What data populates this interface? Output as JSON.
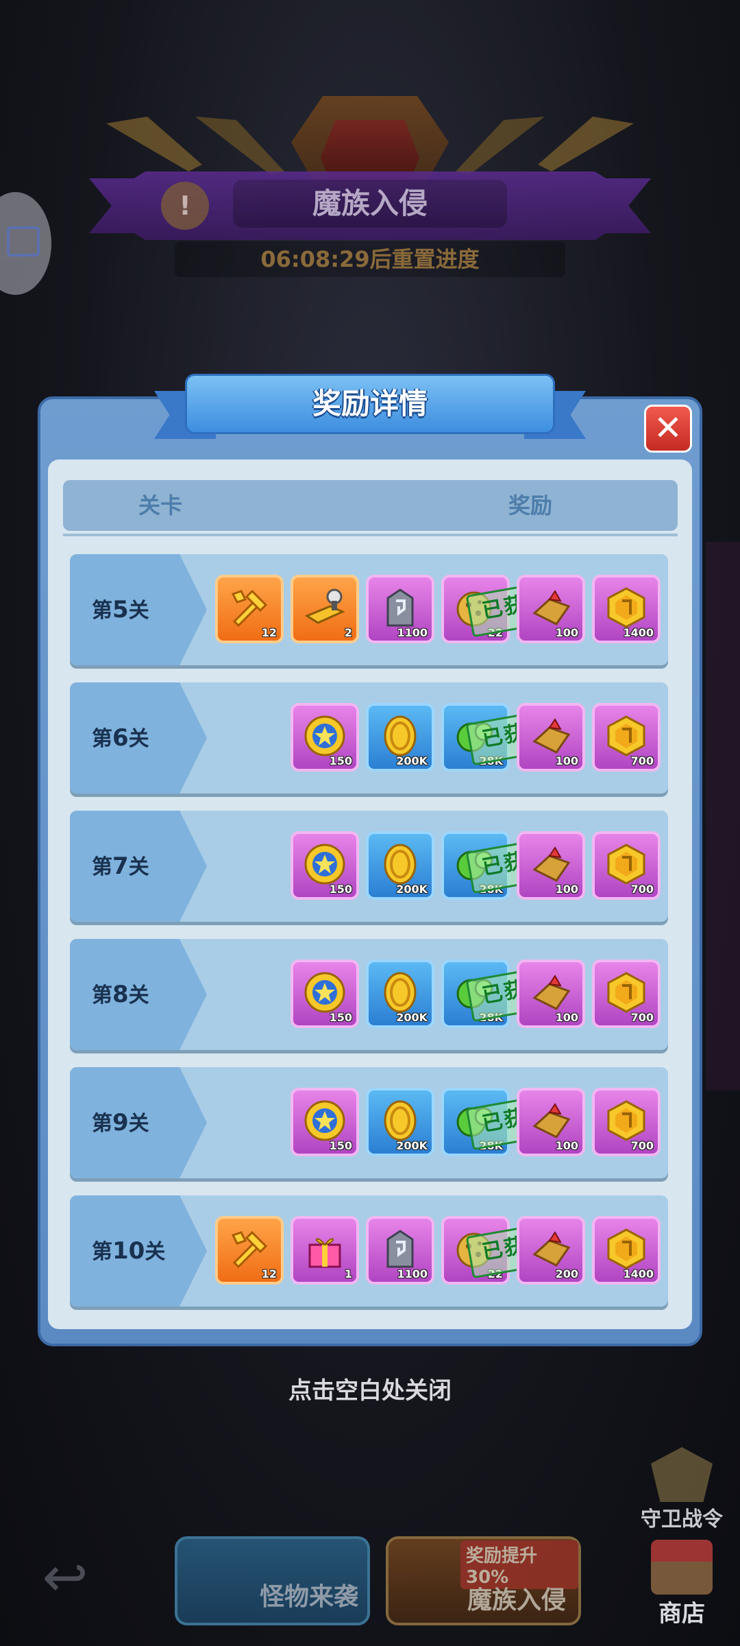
{
  "header": {
    "event_title": "魔族入侵",
    "timer_text": "06:08:29后重置进度",
    "warning_icon": "!"
  },
  "modal": {
    "title": "奖励详情",
    "close_glyph": "✕",
    "col_stage": "关卡",
    "col_reward": "奖励",
    "obtained_text": "已获取",
    "rows": [
      {
        "stage_prefix": "第",
        "stage_num": "5",
        "stage_suffix": "关",
        "items": [
          {
            "icon": "wrench-hammer-icon",
            "style": "orange",
            "count": "12"
          },
          {
            "icon": "golden-scroll-icon",
            "style": "orange",
            "count": "2"
          },
          {
            "icon": "rune-stone-icon",
            "style": "purple",
            "count": "1100"
          },
          {
            "icon": "cookie-icon",
            "style": "purple",
            "count": "22"
          },
          {
            "icon": "red-crystal-icon",
            "style": "purple",
            "count": "100"
          },
          {
            "icon": "gold-hexagon-coin-icon",
            "style": "purple",
            "count": "1400"
          }
        ],
        "obtained_index": 3
      },
      {
        "stage_prefix": "第",
        "stage_num": "6",
        "stage_suffix": "关",
        "items": [
          {
            "icon": "star-medal-icon",
            "style": "purple",
            "count": "150"
          },
          {
            "icon": "gold-coin-icon",
            "style": "blue",
            "count": "200K"
          },
          {
            "icon": "green-gem-icon",
            "style": "blue",
            "count": "28K"
          },
          {
            "icon": "red-crystal-icon",
            "style": "purple",
            "count": "100"
          },
          {
            "icon": "gold-hexagon-coin-icon",
            "style": "purple",
            "count": "700"
          }
        ],
        "obtained_index": 2
      },
      {
        "stage_prefix": "第",
        "stage_num": "7",
        "stage_suffix": "关",
        "items": [
          {
            "icon": "star-medal-icon",
            "style": "purple",
            "count": "150"
          },
          {
            "icon": "gold-coin-icon",
            "style": "blue",
            "count": "200K"
          },
          {
            "icon": "green-gem-icon",
            "style": "blue",
            "count": "28K"
          },
          {
            "icon": "red-crystal-icon",
            "style": "purple",
            "count": "100"
          },
          {
            "icon": "gold-hexagon-coin-icon",
            "style": "purple",
            "count": "700"
          }
        ],
        "obtained_index": 2
      },
      {
        "stage_prefix": "第",
        "stage_num": "8",
        "stage_suffix": "关",
        "items": [
          {
            "icon": "star-medal-icon",
            "style": "purple",
            "count": "150"
          },
          {
            "icon": "gold-coin-icon",
            "style": "blue",
            "count": "200K"
          },
          {
            "icon": "green-gem-icon",
            "style": "blue",
            "count": "28K"
          },
          {
            "icon": "red-crystal-icon",
            "style": "purple",
            "count": "100"
          },
          {
            "icon": "gold-hexagon-coin-icon",
            "style": "purple",
            "count": "700"
          }
        ],
        "obtained_index": 2
      },
      {
        "stage_prefix": "第",
        "stage_num": "9",
        "stage_suffix": "关",
        "items": [
          {
            "icon": "star-medal-icon",
            "style": "purple",
            "count": "150"
          },
          {
            "icon": "gold-coin-icon",
            "style": "blue",
            "count": "200K"
          },
          {
            "icon": "green-gem-icon",
            "style": "blue",
            "count": "28K"
          },
          {
            "icon": "red-crystal-icon",
            "style": "purple",
            "count": "100"
          },
          {
            "icon": "gold-hexagon-coin-icon",
            "style": "purple",
            "count": "700"
          }
        ],
        "obtained_index": 2
      },
      {
        "stage_prefix": "第",
        "stage_num": "10",
        "stage_suffix": "关",
        "items": [
          {
            "icon": "wrench-hammer-icon",
            "style": "orange",
            "count": "12"
          },
          {
            "icon": "gift-box-icon",
            "style": "purple",
            "count": "1"
          },
          {
            "icon": "rune-stone-icon",
            "style": "purple",
            "count": "1100"
          },
          {
            "icon": "cookie-icon",
            "style": "purple",
            "count": "22"
          },
          {
            "icon": "red-crystal-icon",
            "style": "purple",
            "count": "200"
          },
          {
            "icon": "gold-hexagon-coin-icon",
            "style": "purple",
            "count": "1400"
          }
        ],
        "obtained_index": 3
      }
    ]
  },
  "hint": "点击空白处关闭",
  "bottom": {
    "back_glyph": "↩",
    "monster_label": "怪物来袭",
    "demon_label": "魔族入侵",
    "demon_badge": "奖励提升30%",
    "guard_label": "守卫战令",
    "shop_label": "商店"
  },
  "colors": {
    "modal_blue": "#6f9dd0",
    "row_blue": "#a9cde6",
    "stage_blue": "#7fb2dd",
    "obtained_green": "#0f7a26",
    "close_red": "#d9362c"
  }
}
